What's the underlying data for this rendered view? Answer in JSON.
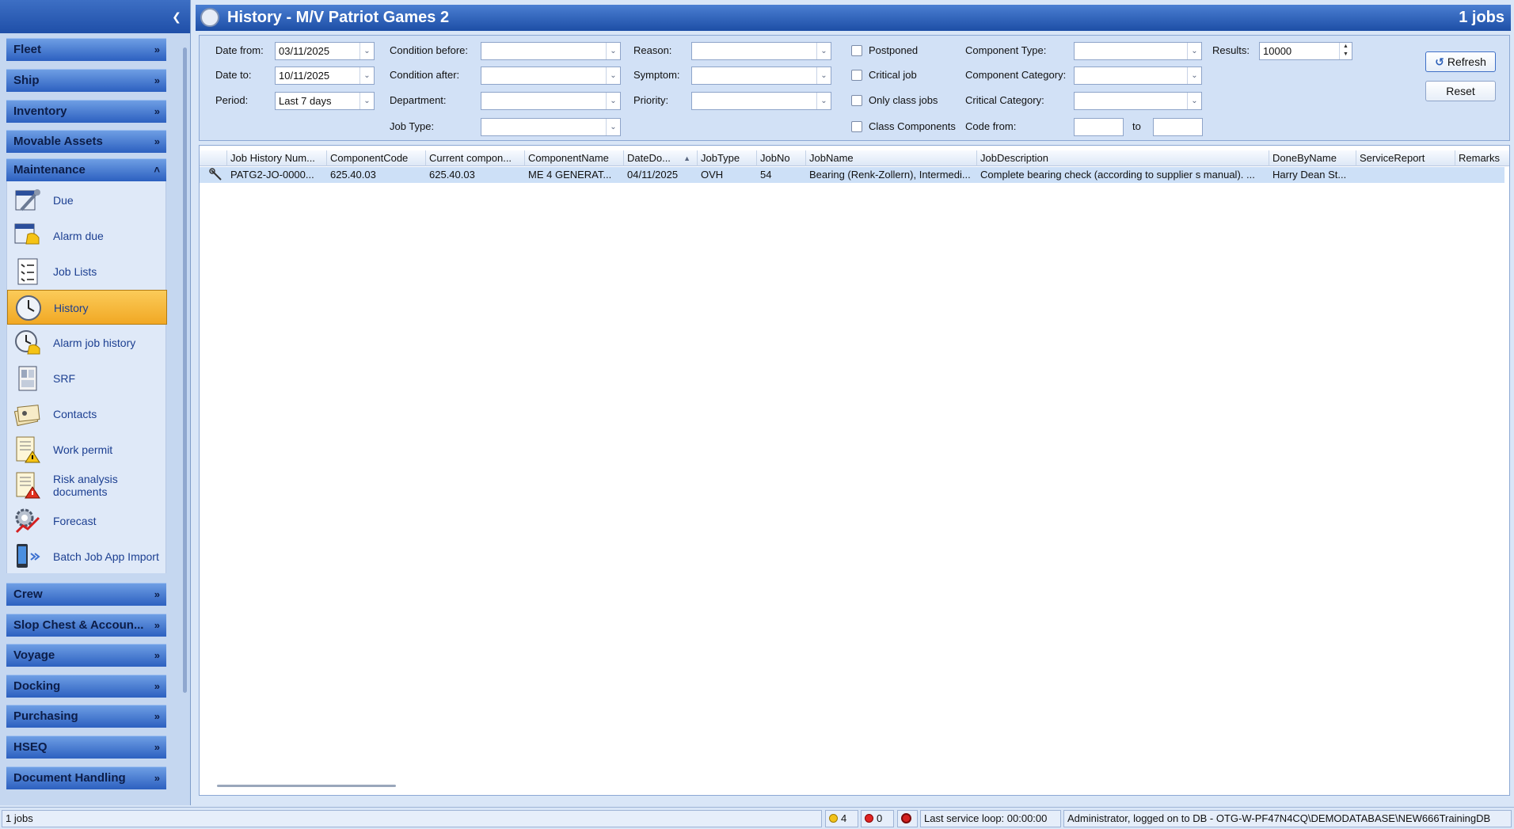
{
  "sidebar": {
    "sections_top": [
      {
        "label": "Fleet"
      },
      {
        "label": "Ship"
      },
      {
        "label": "Inventory"
      },
      {
        "label": "Movable Assets"
      },
      {
        "label": "Maintenance"
      }
    ],
    "maintenance_items": [
      {
        "label": "Due",
        "icon": "tools-calendar-icon"
      },
      {
        "label": "Alarm due",
        "icon": "alarm-calendar-icon"
      },
      {
        "label": "Job Lists",
        "icon": "checklist-icon"
      },
      {
        "label": "History",
        "icon": "clock-history-icon",
        "selected": true
      },
      {
        "label": "Alarm job history",
        "icon": "alarm-clock-icon"
      },
      {
        "label": "SRF",
        "icon": "form-icon"
      },
      {
        "label": "Contacts",
        "icon": "contacts-icon"
      },
      {
        "label": "Work permit",
        "icon": "permit-warning-icon"
      },
      {
        "label": "Risk analysis documents",
        "icon": "risk-document-icon"
      },
      {
        "label": "Forecast",
        "icon": "forecast-gear-icon"
      },
      {
        "label": "Batch Job App Import",
        "icon": "phone-import-icon"
      }
    ],
    "sections_bottom": [
      {
        "label": "Crew"
      },
      {
        "label": "Slop Chest & Accoun..."
      },
      {
        "label": "Voyage"
      },
      {
        "label": "Docking"
      },
      {
        "label": "Purchasing"
      },
      {
        "label": "HSEQ"
      },
      {
        "label": "Document Handling"
      }
    ]
  },
  "title": {
    "text": "History - M/V Patriot Games 2",
    "count": "1 jobs"
  },
  "filters": {
    "date_from_label": "Date from:",
    "date_from": "03/11/2025",
    "date_to_label": "Date to:",
    "date_to": "10/11/2025",
    "period_label": "Period:",
    "period": "Last 7 days",
    "condition_before_label": "Condition before:",
    "condition_after_label": "Condition after:",
    "department_label": "Department:",
    "job_type_label": "Job Type:",
    "reason_label": "Reason:",
    "symptom_label": "Symptom:",
    "priority_label": "Priority:",
    "postponed_label": "Postponed",
    "critical_job_label": "Critical job",
    "only_class_jobs_label": "Only class jobs",
    "class_components_label": "Class Components",
    "component_type_label": "Component Type:",
    "component_category_label": "Component Category:",
    "critical_category_label": "Critical Category:",
    "code_from_label": "Code from:",
    "code_to_label": "to",
    "results_label": "Results:",
    "results": "10000",
    "refresh_label": "Refresh",
    "reset_label": "Reset"
  },
  "grid": {
    "columns": [
      "Job History Num...",
      "ComponentCode",
      "Current compon...",
      "ComponentName",
      "DateDo...",
      "JobType",
      "JobNo",
      "JobName",
      "JobDescription",
      "DoneByName",
      "ServiceReport",
      "Remarks"
    ],
    "rows": [
      [
        "PATG2-JO-0000...",
        "625.40.03",
        "625.40.03",
        "ME 4 GENERAT...",
        "04/11/2025",
        "OVH",
        "54",
        "Bearing (Renk-Zollern), Intermedi...",
        "Complete bearing check (according to supplier s manual). ...",
        "Harry Dean St...",
        "",
        ""
      ]
    ]
  },
  "status": {
    "jobs": "1 jobs",
    "warnings": "4",
    "errors": "0",
    "service_loop": "Last service loop: 00:00:00",
    "login": "Administrator, logged on to DB - OTG-W-PF47N4CQ\\DEMODATABASE\\NEW666TrainingDB"
  }
}
